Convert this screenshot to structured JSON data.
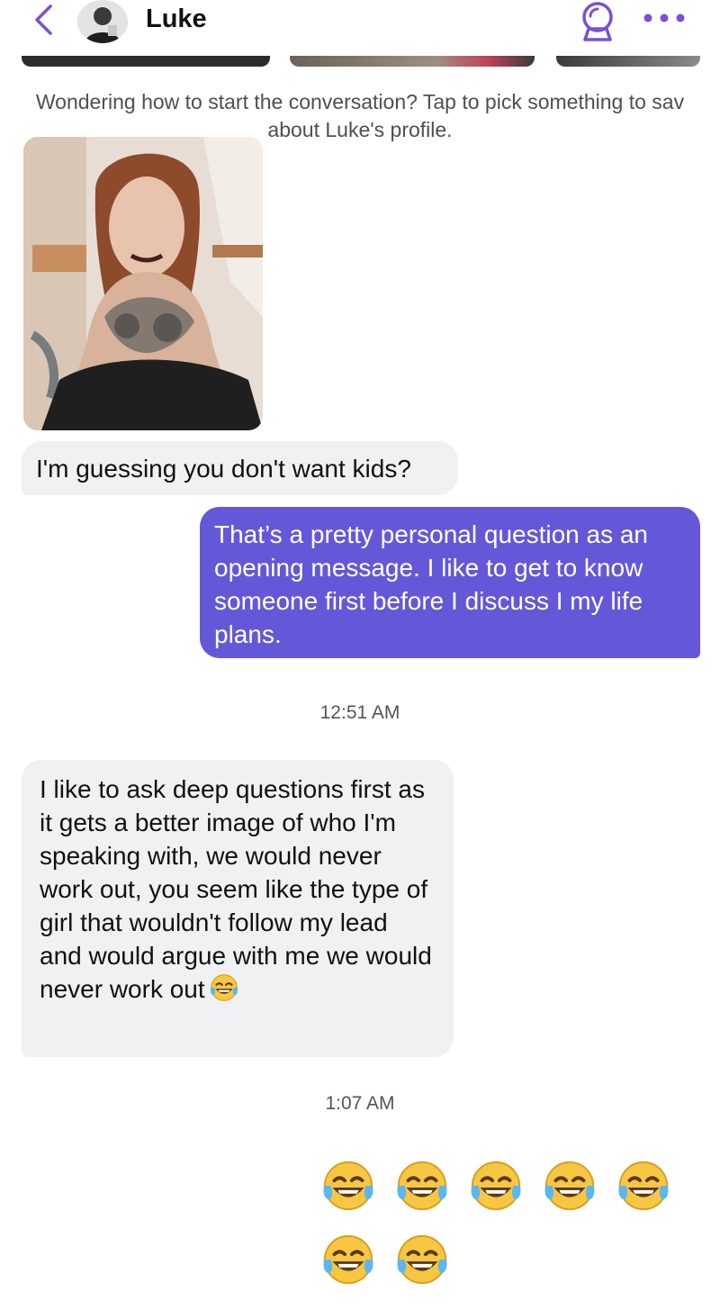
{
  "header": {
    "contact_name": "Luke",
    "back_icon": "chevron-left-icon",
    "profile_icon": "crystal-ball-icon",
    "more_icon": "ellipsis-icon",
    "accent_color": "#7b4fd6"
  },
  "prompt": {
    "text": "Wondering how to start the conversation? Tap to pick something to sav about Luke's profile."
  },
  "messages": [
    {
      "sender": "them",
      "text": "I'm guessing you don't want kids?"
    },
    {
      "sender": "me",
      "text": "That’s a pretty personal question as an opening message. I like to get to know someone first before I discuss I my life plans."
    },
    {
      "timestamp": "12:51 AM"
    },
    {
      "sender": "them",
      "text": "I like to ask deep questions first as it gets a better image of who I'm speaking with, we would never work out, you seem like the type of girl that wouldn't follow my lead and would argue with me we would never work out",
      "trailing_emoji": "face-with-tears-of-joy"
    },
    {
      "timestamp": "1:07 AM"
    },
    {
      "sender": "me",
      "emoji": "face-with-tears-of-joy",
      "count": 7
    }
  ],
  "colors": {
    "incoming_bubble": "#f0f1f3",
    "outgoing_bubble": "#6458d8",
    "outgoing_text": "#ffffff"
  }
}
